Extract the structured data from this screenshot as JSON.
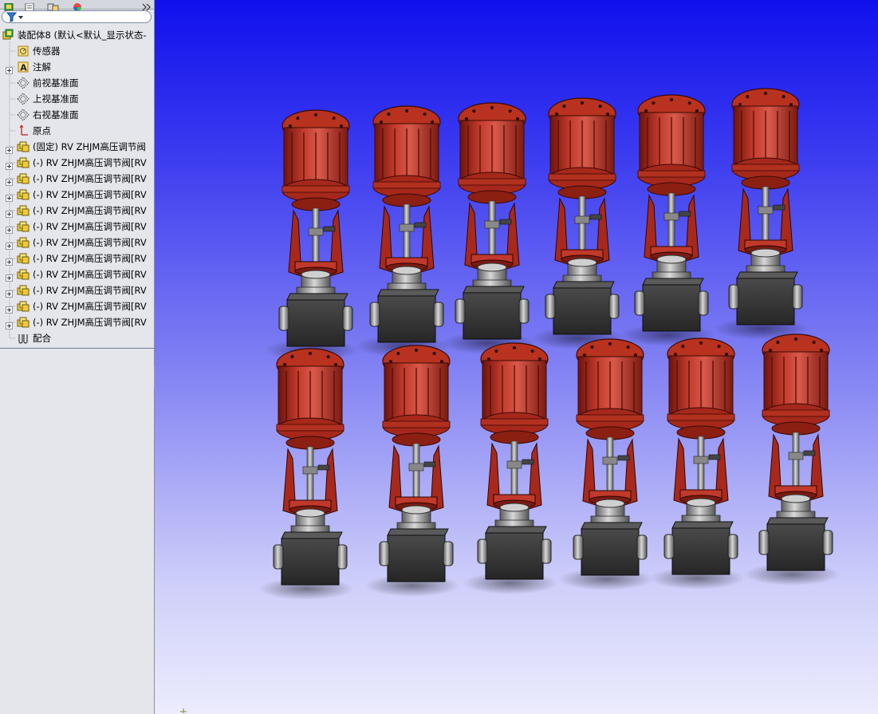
{
  "feature_tree": {
    "root_label": "装配体8  (默认<默认_显示状态-",
    "items": [
      {
        "label": "传感器",
        "icon": "sensor-icon"
      },
      {
        "label": "注解",
        "icon": "annotation-icon"
      },
      {
        "label": "前视基准面",
        "icon": "plane-icon"
      },
      {
        "label": "上视基准面",
        "icon": "plane-icon"
      },
      {
        "label": "右视基准面",
        "icon": "plane-icon"
      },
      {
        "label": "原点",
        "icon": "origin-icon"
      },
      {
        "label": "(固定) RV ZHJM高压调节阀",
        "icon": "part-icon"
      },
      {
        "label": "(-) RV ZHJM高压调节阀[RV",
        "icon": "part-icon"
      },
      {
        "label": "(-) RV ZHJM高压调节阀[RV",
        "icon": "part-icon"
      },
      {
        "label": "(-) RV ZHJM高压调节阀[RV",
        "icon": "part-icon"
      },
      {
        "label": "(-) RV ZHJM高压调节阀[RV",
        "icon": "part-icon"
      },
      {
        "label": "(-) RV ZHJM高压调节阀[RV",
        "icon": "part-icon"
      },
      {
        "label": "(-) RV ZHJM高压调节阀[RV",
        "icon": "part-icon"
      },
      {
        "label": "(-) RV ZHJM高压调节阀[RV",
        "icon": "part-icon"
      },
      {
        "label": "(-) RV ZHJM高压调节阀[RV",
        "icon": "part-icon"
      },
      {
        "label": "(-) RV ZHJM高压调节阀[RV",
        "icon": "part-icon"
      },
      {
        "label": "(-) RV ZHJM高压调节阀[RV",
        "icon": "part-icon"
      },
      {
        "label": "(-) RV ZHJM高压调节阀[RV",
        "icon": "part-icon"
      },
      {
        "label": "配合",
        "icon": "mates-icon"
      }
    ]
  },
  "panel_tabs": [
    "feature-manager-tab-icon",
    "property-manager-tab-icon",
    "configuration-manager-tab-icon",
    "display-manager-tab-icon",
    "expand-panel-icon"
  ],
  "viewport": {
    "valve_count": 12,
    "colors": {
      "background_top": "#1010ee",
      "background_bottom": "#ececfd",
      "actuator_red": "#c0392b",
      "actuator_dark": "#7a1b12",
      "valve_body": "#3a3a3a",
      "stem_metal": "#b5b5b5"
    }
  }
}
